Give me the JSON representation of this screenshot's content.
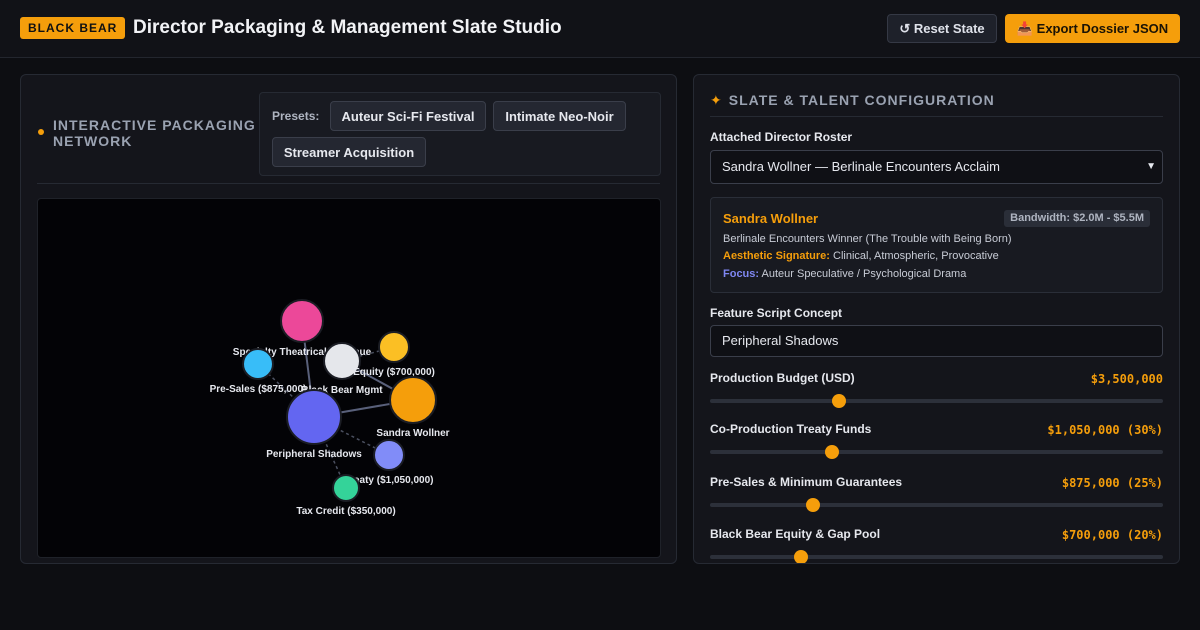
{
  "header": {
    "brand": "BLACK BEAR",
    "title": "Director Packaging & Management Slate Studio",
    "reset_label": "↺ Reset State",
    "export_label": "📥 Export Dossier JSON"
  },
  "network_panel": {
    "title": "INTERACTIVE PACKAGING NETWORK",
    "presets_label": "Presets:",
    "presets": [
      "Auteur Sci-Fi Festival",
      "Intimate Neo-Noir",
      "Streamer Acquisition"
    ],
    "nodes": [
      {
        "id": "specialty",
        "label": "Specialty Theatrical Revenue",
        "color": "#ec4899"
      },
      {
        "id": "presales",
        "label": "Pre-Sales ($875,000)",
        "color": "#38bdf8"
      },
      {
        "id": "blackbear",
        "label": "Black Bear Mgmt",
        "color": "#e5e7eb"
      },
      {
        "id": "equity",
        "label": "Equity ($700,000)",
        "color": "#fbbf24"
      },
      {
        "id": "director",
        "label": "Sandra Wollner",
        "color": "#f59e0b"
      },
      {
        "id": "project",
        "label": "Peripheral Shadows",
        "color": "#6366f1"
      },
      {
        "id": "treaty",
        "label": "Treaty ($1,050,000)",
        "color": "#818cf8"
      },
      {
        "id": "taxcredit",
        "label": "Tax Credit ($350,000)",
        "color": "#34d399"
      }
    ]
  },
  "config_panel": {
    "title": "SLATE & TALENT CONFIGURATION",
    "roster_label": "Attached Director Roster",
    "roster_selected": "Sandra Wollner — Berlinale Encounters Acclaim",
    "director": {
      "name": "Sandra Wollner",
      "bandwidth": "Bandwidth: $2.0M - $5.5M",
      "award": "Berlinale Encounters Winner (The Trouble with Being Born)",
      "aesthetic_key": "Aesthetic Signature:",
      "aesthetic_value": "Clinical, Atmospheric, Provocative",
      "focus_key": "Focus:",
      "focus_value": "Auteur Speculative / Psychological Drama"
    },
    "script_label": "Feature Script Concept",
    "script_value": "Peripheral Shadows",
    "sliders": [
      {
        "label": "Production Budget (USD)",
        "value": "$3,500,000",
        "fraction": 0.285
      },
      {
        "label": "Co-Production Treaty Funds",
        "value": "$1,050,000 (30%)",
        "fraction": 0.27
      },
      {
        "label": "Pre-Sales & Minimum Guarantees",
        "value": "$875,000 (25%)",
        "fraction": 0.227
      },
      {
        "label": "Black Bear Equity & Gap Pool",
        "value": "$700,000 (20%)",
        "fraction": 0.2
      }
    ]
  }
}
